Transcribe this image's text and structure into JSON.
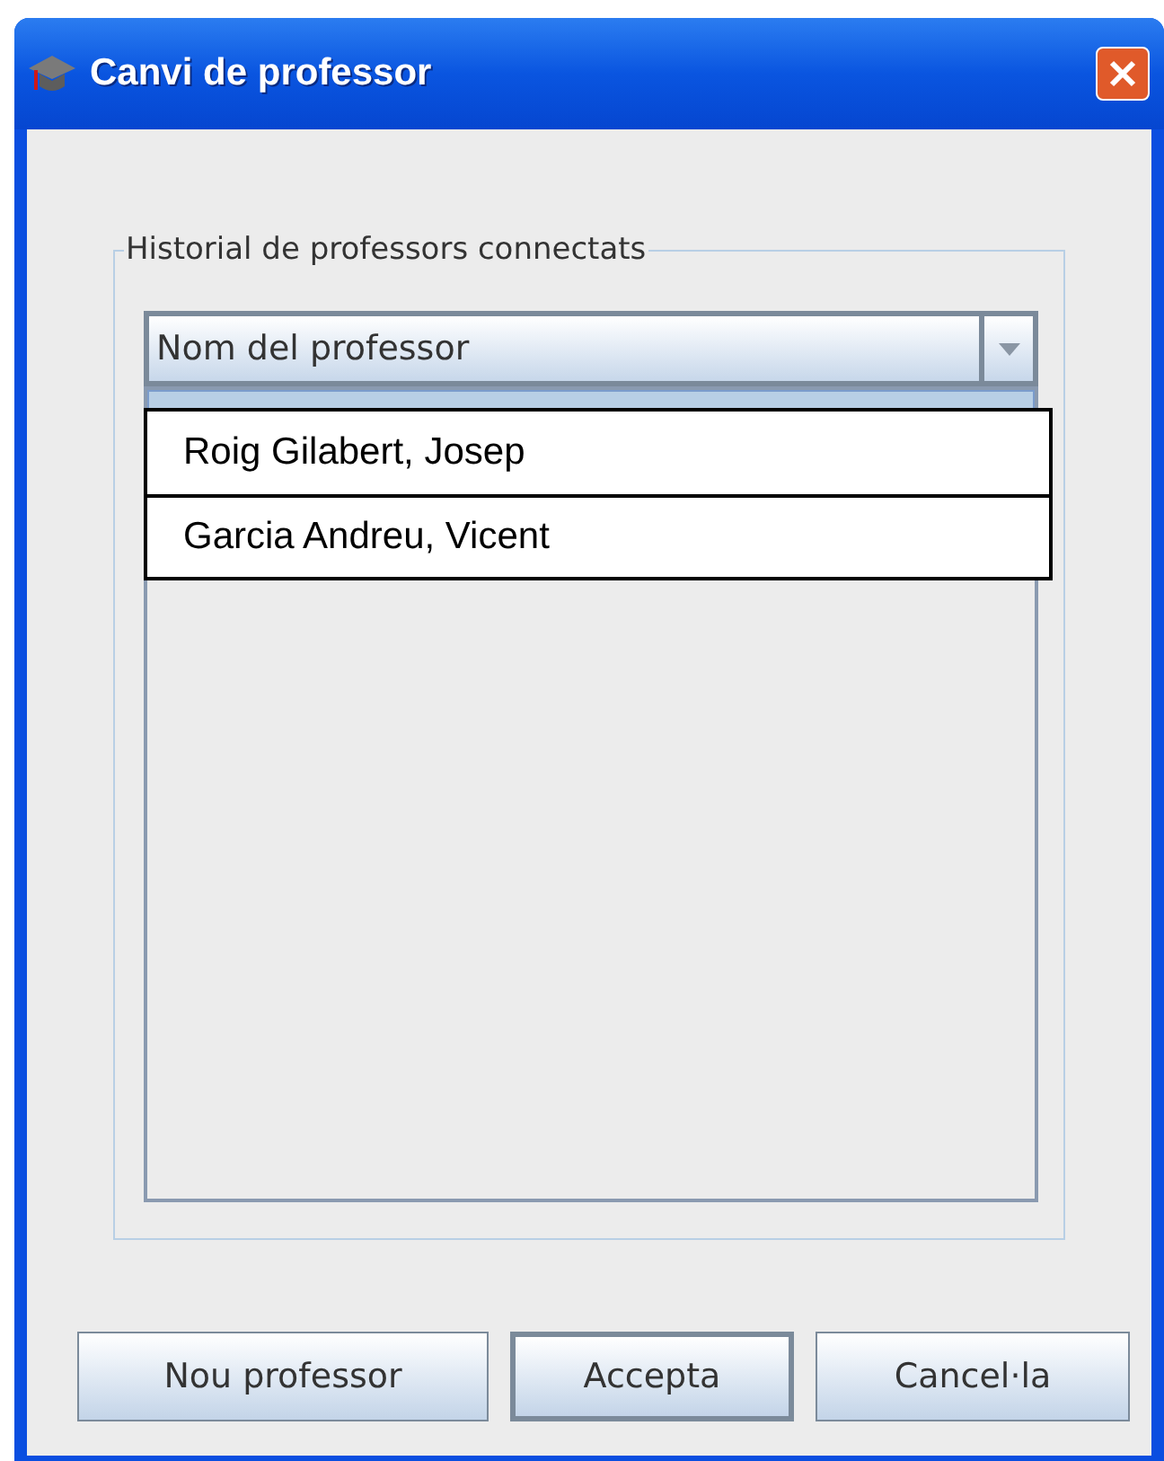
{
  "window": {
    "title": "Canvi de professor"
  },
  "group": {
    "title": "Historial de professors connectats"
  },
  "combo": {
    "value": "Nom del professor"
  },
  "list": {
    "first_row_highlighted": true
  },
  "popup": {
    "items": [
      {
        "label": "Roig Gilabert, Josep"
      },
      {
        "label": "Garcia Andreu, Vicent"
      }
    ]
  },
  "buttons": [
    {
      "label": "Nou professor",
      "default": false
    },
    {
      "label": "Accepta",
      "default": true
    },
    {
      "label": "Cancel·la",
      "default": false
    }
  ]
}
